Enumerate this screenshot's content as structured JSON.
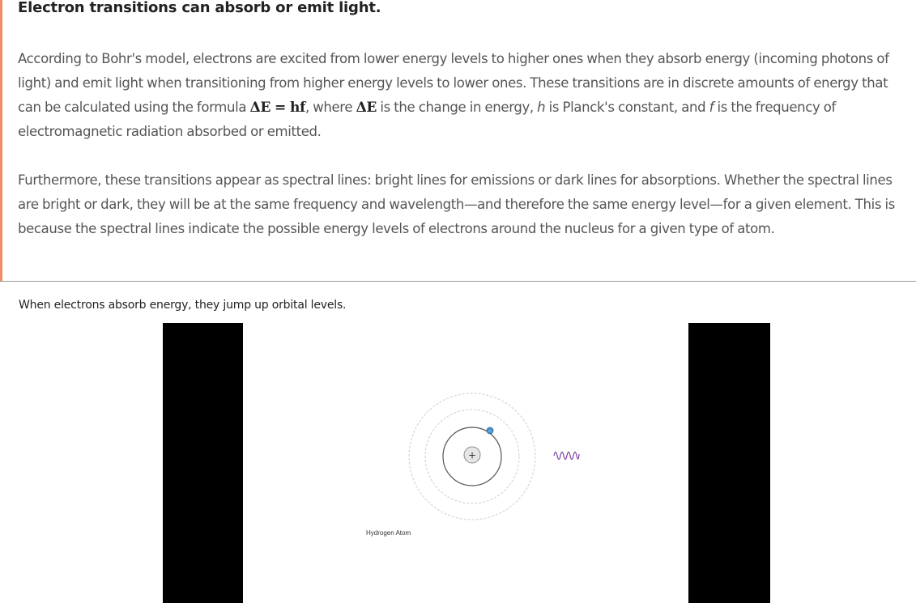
{
  "heading": "Electron transitions can absorb or emit light.",
  "paragraph1": {
    "part1": "According to Bohr's model, electrons are excited from lower energy levels to higher ones when they absorb energy (incoming photons of light) and emit light when transitioning from higher energy levels to lower ones. These transitions are in discrete amounts of energy that can be calculated using the formula ",
    "formula": "ΔE = hf",
    "part2": ", where ",
    "delta_e": "ΔE",
    "part3": " is the change in energy, ",
    "h": "h",
    "part4": " is Planck's constant, and ",
    "f": "f",
    "part5": " is the frequency of electromagnetic radiation absorbed or emitted."
  },
  "paragraph2": "Furthermore, these transitions appear as spectral lines: bright lines for emissions or dark lines for absorptions. Whether the spectral lines are bright or dark, they will be at the same frequency and wavelength—and therefore the same energy level—for a given element. This is because the spectral lines indicate the possible energy levels of electrons around the nucleus for a given type of atom.",
  "caption": "When electrons absorb energy, they jump up orbital levels.",
  "video": {
    "atom_label": "Hydrogen Atom",
    "nucleus_symbol": "+",
    "electron_symbol": "−",
    "photon_color": "#7b3fa0",
    "electron_color": "#4a90c8"
  },
  "colors": {
    "accent": "#f08a6b",
    "heading": "#222222",
    "body_text": "#555555"
  }
}
